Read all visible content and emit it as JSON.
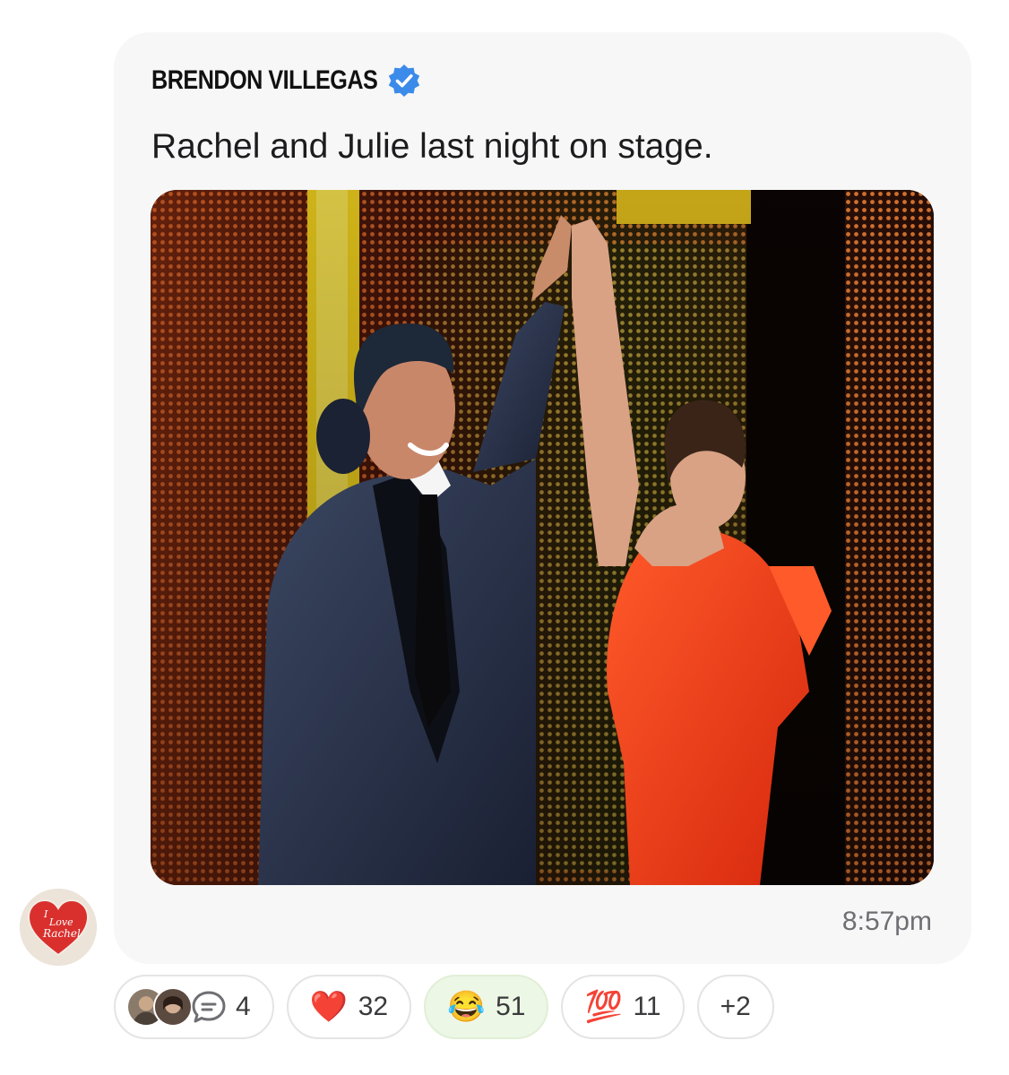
{
  "message": {
    "sender_name": "BRENDON VILLEGAS",
    "sender_verified": true,
    "text": "Rachel and Julie last night on stage.",
    "timestamp": "8:57pm",
    "image_label": "Two performers on stage in front of a glowing LED wall"
  },
  "avatar": {
    "label_line1": "I",
    "label_line2": "Love",
    "label_line3": "Rachel"
  },
  "reactions": {
    "replies": {
      "count": "4",
      "icon": "speech-bubble-icon"
    },
    "items": [
      {
        "emoji": "❤️",
        "name": "heart",
        "count": "32",
        "active": false
      },
      {
        "emoji": "😂",
        "name": "joy",
        "count": "51",
        "active": true
      },
      {
        "emoji": "💯",
        "name": "hundred",
        "count": "11",
        "active": false
      }
    ],
    "more": "+2"
  },
  "colors": {
    "bubble_bg": "#f7f7f7",
    "verified_blue": "#3b8bea",
    "active_reaction_bg": "#edf7e6",
    "heart_red": "#d9302e"
  }
}
